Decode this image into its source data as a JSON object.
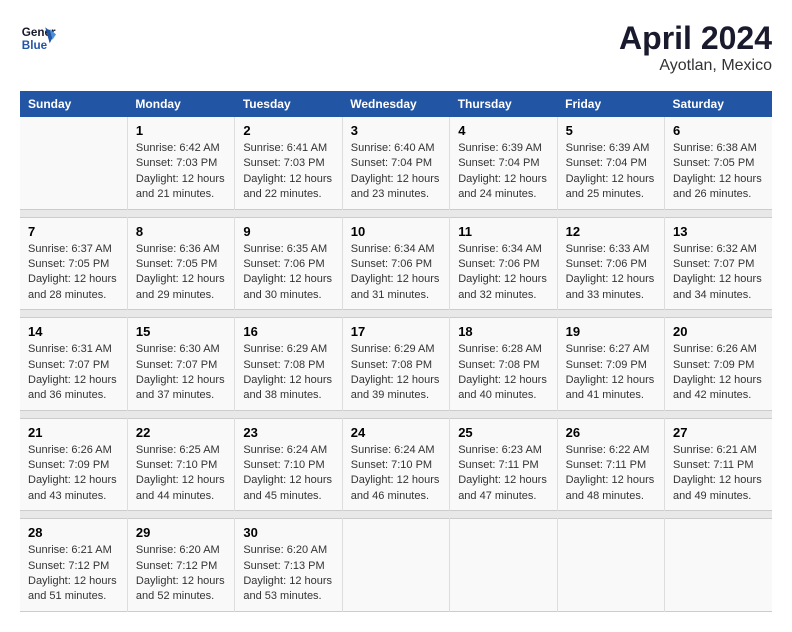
{
  "header": {
    "logo_line1": "General",
    "logo_line2": "Blue",
    "title": "April 2024",
    "subtitle": "Ayotlan, Mexico"
  },
  "days_of_week": [
    "Sunday",
    "Monday",
    "Tuesday",
    "Wednesday",
    "Thursday",
    "Friday",
    "Saturday"
  ],
  "weeks": [
    {
      "cells": [
        {
          "day": "",
          "content": ""
        },
        {
          "day": "1",
          "content": "Sunrise: 6:42 AM\nSunset: 7:03 PM\nDaylight: 12 hours\nand 21 minutes."
        },
        {
          "day": "2",
          "content": "Sunrise: 6:41 AM\nSunset: 7:03 PM\nDaylight: 12 hours\nand 22 minutes."
        },
        {
          "day": "3",
          "content": "Sunrise: 6:40 AM\nSunset: 7:04 PM\nDaylight: 12 hours\nand 23 minutes."
        },
        {
          "day": "4",
          "content": "Sunrise: 6:39 AM\nSunset: 7:04 PM\nDaylight: 12 hours\nand 24 minutes."
        },
        {
          "day": "5",
          "content": "Sunrise: 6:39 AM\nSunset: 7:04 PM\nDaylight: 12 hours\nand 25 minutes."
        },
        {
          "day": "6",
          "content": "Sunrise: 6:38 AM\nSunset: 7:05 PM\nDaylight: 12 hours\nand 26 minutes."
        }
      ]
    },
    {
      "cells": [
        {
          "day": "7",
          "content": "Sunrise: 6:37 AM\nSunset: 7:05 PM\nDaylight: 12 hours\nand 28 minutes."
        },
        {
          "day": "8",
          "content": "Sunrise: 6:36 AM\nSunset: 7:05 PM\nDaylight: 12 hours\nand 29 minutes."
        },
        {
          "day": "9",
          "content": "Sunrise: 6:35 AM\nSunset: 7:06 PM\nDaylight: 12 hours\nand 30 minutes."
        },
        {
          "day": "10",
          "content": "Sunrise: 6:34 AM\nSunset: 7:06 PM\nDaylight: 12 hours\nand 31 minutes."
        },
        {
          "day": "11",
          "content": "Sunrise: 6:34 AM\nSunset: 7:06 PM\nDaylight: 12 hours\nand 32 minutes."
        },
        {
          "day": "12",
          "content": "Sunrise: 6:33 AM\nSunset: 7:06 PM\nDaylight: 12 hours\nand 33 minutes."
        },
        {
          "day": "13",
          "content": "Sunrise: 6:32 AM\nSunset: 7:07 PM\nDaylight: 12 hours\nand 34 minutes."
        }
      ]
    },
    {
      "cells": [
        {
          "day": "14",
          "content": "Sunrise: 6:31 AM\nSunset: 7:07 PM\nDaylight: 12 hours\nand 36 minutes."
        },
        {
          "day": "15",
          "content": "Sunrise: 6:30 AM\nSunset: 7:07 PM\nDaylight: 12 hours\nand 37 minutes."
        },
        {
          "day": "16",
          "content": "Sunrise: 6:29 AM\nSunset: 7:08 PM\nDaylight: 12 hours\nand 38 minutes."
        },
        {
          "day": "17",
          "content": "Sunrise: 6:29 AM\nSunset: 7:08 PM\nDaylight: 12 hours\nand 39 minutes."
        },
        {
          "day": "18",
          "content": "Sunrise: 6:28 AM\nSunset: 7:08 PM\nDaylight: 12 hours\nand 40 minutes."
        },
        {
          "day": "19",
          "content": "Sunrise: 6:27 AM\nSunset: 7:09 PM\nDaylight: 12 hours\nand 41 minutes."
        },
        {
          "day": "20",
          "content": "Sunrise: 6:26 AM\nSunset: 7:09 PM\nDaylight: 12 hours\nand 42 minutes."
        }
      ]
    },
    {
      "cells": [
        {
          "day": "21",
          "content": "Sunrise: 6:26 AM\nSunset: 7:09 PM\nDaylight: 12 hours\nand 43 minutes."
        },
        {
          "day": "22",
          "content": "Sunrise: 6:25 AM\nSunset: 7:10 PM\nDaylight: 12 hours\nand 44 minutes."
        },
        {
          "day": "23",
          "content": "Sunrise: 6:24 AM\nSunset: 7:10 PM\nDaylight: 12 hours\nand 45 minutes."
        },
        {
          "day": "24",
          "content": "Sunrise: 6:24 AM\nSunset: 7:10 PM\nDaylight: 12 hours\nand 46 minutes."
        },
        {
          "day": "25",
          "content": "Sunrise: 6:23 AM\nSunset: 7:11 PM\nDaylight: 12 hours\nand 47 minutes."
        },
        {
          "day": "26",
          "content": "Sunrise: 6:22 AM\nSunset: 7:11 PM\nDaylight: 12 hours\nand 48 minutes."
        },
        {
          "day": "27",
          "content": "Sunrise: 6:21 AM\nSunset: 7:11 PM\nDaylight: 12 hours\nand 49 minutes."
        }
      ]
    },
    {
      "cells": [
        {
          "day": "28",
          "content": "Sunrise: 6:21 AM\nSunset: 7:12 PM\nDaylight: 12 hours\nand 51 minutes."
        },
        {
          "day": "29",
          "content": "Sunrise: 6:20 AM\nSunset: 7:12 PM\nDaylight: 12 hours\nand 52 minutes."
        },
        {
          "day": "30",
          "content": "Sunrise: 6:20 AM\nSunset: 7:13 PM\nDaylight: 12 hours\nand 53 minutes."
        },
        {
          "day": "",
          "content": ""
        },
        {
          "day": "",
          "content": ""
        },
        {
          "day": "",
          "content": ""
        },
        {
          "day": "",
          "content": ""
        }
      ]
    }
  ]
}
